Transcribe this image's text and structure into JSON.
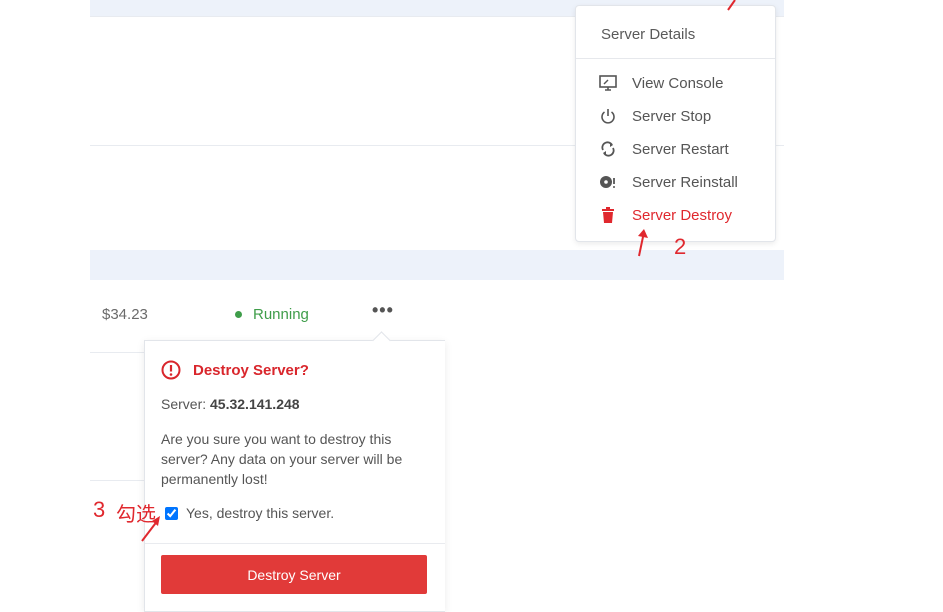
{
  "row": {
    "price": "$34.23",
    "status": "Running",
    "more_icon": "more-dots-icon"
  },
  "menu": {
    "title": "Server Details",
    "items": [
      {
        "label": "View Console",
        "icon": "console-monitor-icon"
      },
      {
        "label": "Server Stop",
        "icon": "power-icon"
      },
      {
        "label": "Server Restart",
        "icon": "restart-icon"
      },
      {
        "label": "Server Reinstall",
        "icon": "reinstall-disc-icon"
      },
      {
        "label": "Server Destroy",
        "icon": "trash-icon"
      }
    ]
  },
  "popover": {
    "title": "Destroy Server?",
    "server_label": "Server:",
    "server_ip": "45.32.141.248",
    "message": "Are you sure you want to destroy this server? Any data on your server will be permanently lost!",
    "checkbox_label": "Yes, destroy this server.",
    "button_label": "Destroy Server"
  },
  "annotations": {
    "step2": "2",
    "step3": "3",
    "step3_text": "勾选"
  },
  "colors": {
    "danger": "#e0282e",
    "success": "#3f9d4a",
    "band": "#edf2fa"
  }
}
